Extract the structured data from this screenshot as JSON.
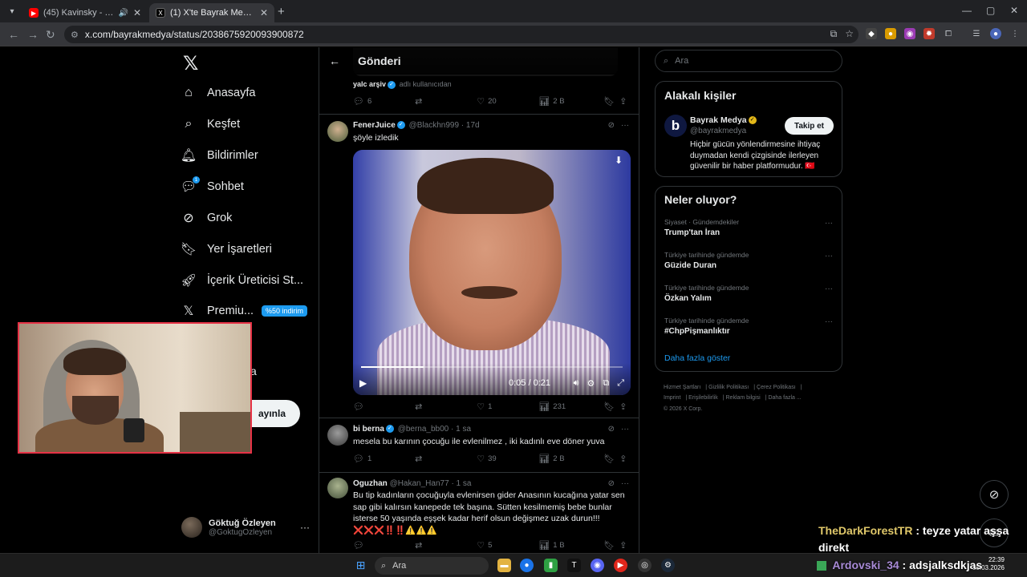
{
  "browser": {
    "tabs": [
      {
        "title": "(45) Kavinsky - Nightcall (D",
        "favicon_color": "#ff0000"
      },
      {
        "title": "(1) X'te Bayrak Medya: \"Sosyal",
        "favicon_color": "#000000"
      }
    ],
    "new_tab": "+",
    "url": "x.com/bayrakmedya/status/2038675920093900872"
  },
  "nav": {
    "items": [
      {
        "label": "Anasayfa",
        "icon": "⌂"
      },
      {
        "label": "Keşfet",
        "icon": "⌕"
      },
      {
        "label": "Bildirimler",
        "icon": "♫"
      },
      {
        "label": "Sohbet",
        "icon": "✉"
      },
      {
        "label": "Grok",
        "icon": "⊘"
      },
      {
        "label": "Yer İşaretleri",
        "icon": "⚑"
      },
      {
        "label": "İçerik Üreticisi St...",
        "icon": "➚"
      },
      {
        "label": "Premiu...",
        "icon": "𝕏"
      }
    ],
    "chat_badge": "1",
    "premium_discount": "%50 indirim",
    "more_fragment": "a",
    "post_button": "ayınla",
    "account": {
      "name": "Göktuğ Özleyen",
      "handle": "@GoktugOzleyen"
    }
  },
  "main": {
    "back": "←",
    "title": "Gönderi",
    "prev_tweet": {
      "ref_name": "yalc arşiv",
      "ref_suffix": "adlı kullanıcıdan",
      "replies": "6",
      "reposts": "",
      "likes": "20",
      "views": "2 B"
    },
    "tweets": [
      {
        "name": "FenerJuice",
        "handle": "@Blackhn999",
        "time": "· 17d",
        "text": "şöyle izledik",
        "video": {
          "time": "0:05 / 0:21",
          "progress": 0.24
        },
        "replies": "",
        "reposts": "",
        "likes": "1",
        "views": "231"
      },
      {
        "name": "bi berna",
        "handle": "@berna_bb00",
        "time": "· 1 sa",
        "text": "mesela bu karının çocuğu ile evlenilmez , iki kadınlı eve döner yuva",
        "replies": "1",
        "reposts": "",
        "likes": "39",
        "views": "2 B"
      },
      {
        "name": "Oguzhan",
        "handle": "@Hakan_Han77",
        "time": "· 1 sa",
        "text": "Bu tip kadınların çocuğuyla evlenirsen gider Anasının kucağına yatar sen sap gibi kalırsın kanepede tek başına. Sütten kesilmemiş bebe bunlar isterse 50 yaşında eşşek kadar herif olsun değişmez uzak durun!!!❌❌❌‼️‼️⚠️⚠️⚠️",
        "replies": "",
        "reposts": "",
        "likes": "5",
        "views": "1 B"
      }
    ]
  },
  "right": {
    "search_placeholder": "Ara",
    "related": {
      "title": "Alakalı kişiler",
      "name": "Bayrak Medya",
      "handle": "@bayrakmedya",
      "follow": "Takip et",
      "bio": "Hiçbir gücün yönlendirmesine ihtiyaç duymadan kendi çizgisinde ilerleyen güvenilir bir haber platformudur. 🇹🇷"
    },
    "trends": {
      "title": "Neler oluyor?",
      "items": [
        {
          "category": "Siyaset · Gündemdekiler",
          "topic": "Trump'tan İran"
        },
        {
          "category": "Türkiye tarihinde gündemde",
          "topic": "Güzide Duran"
        },
        {
          "category": "Türkiye tarihinde gündemde",
          "topic": "Özkan Yalım"
        },
        {
          "category": "Türkiye tarihinde gündemde",
          "topic": "#ChpPişmanlıktır"
        }
      ],
      "show_more": "Daha fazla göster"
    },
    "footer": [
      "Hizmet Şartları",
      "Gizlilik Politikası",
      "Çerez Politikası",
      "Imprint",
      "Erişilebilirlik",
      "Reklam bilgisi",
      "Daha fazla ...",
      "© 2026 X Corp."
    ]
  },
  "stream": {
    "chat": [
      {
        "user": "TheDarkForestTR",
        "message": ": teyze yatar aşşa direkt"
      },
      {
        "user": "Ardovski_34",
        "message": ": adsjalksdkjas"
      }
    ]
  },
  "taskbar": {
    "search": "Ara",
    "time": "22:39",
    "date": "30.03.2026"
  },
  "colors": {
    "accent": "#1d9bf0",
    "webcam_border": "#e63246"
  }
}
